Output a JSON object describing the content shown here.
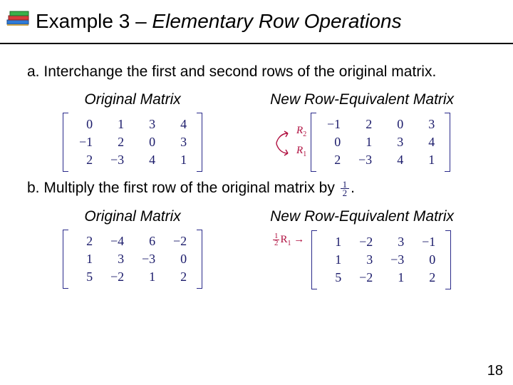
{
  "title": {
    "lead": "Example 3 – ",
    "ital": "Elementary Row Operations"
  },
  "partA": {
    "label": "a.",
    "text": "Interchange the first and second rows of the original matrix.",
    "left_head": "Original Matrix",
    "right_head": "New Row-Equivalent Matrix",
    "original": [
      [
        "0",
        "1",
        "3",
        "4"
      ],
      [
        "−1",
        "2",
        "0",
        "3"
      ],
      [
        "2",
        "−3",
        "4",
        "1"
      ]
    ],
    "result": [
      [
        "−1",
        "2",
        "0",
        "3"
      ],
      [
        "0",
        "1",
        "3",
        "4"
      ],
      [
        "2",
        "−3",
        "4",
        "1"
      ]
    ],
    "rowlabels": [
      "R",
      "2",
      "R",
      "1"
    ],
    "swap_icon": "row-swap-arrow"
  },
  "partB": {
    "label": "b.",
    "text_pre": "Multiply the first row of the original matrix by ",
    "frac_num": "1",
    "frac_den": "2",
    "text_post": ".",
    "left_head": "Original Matrix",
    "right_head": "New Row-Equivalent Matrix",
    "original": [
      [
        "2",
        "−4",
        "6",
        "−2"
      ],
      [
        "1",
        "3",
        "−3",
        "0"
      ],
      [
        "5",
        "−2",
        "1",
        "2"
      ]
    ],
    "result": [
      [
        "1",
        "−2",
        "3",
        "−1"
      ],
      [
        "1",
        "3",
        "−3",
        "0"
      ],
      [
        "5",
        "−2",
        "1",
        "2"
      ]
    ],
    "rowop": {
      "frac_num": "1",
      "frac_den": "2",
      "R": "R",
      "sub": "1",
      "arrow": "→"
    }
  },
  "page_number": "18",
  "chart_data": {
    "type": "table",
    "title": "Elementary Row Operations example matrices",
    "tables": [
      {
        "name": "a_original",
        "rows": [
          [
            0,
            1,
            3,
            4
          ],
          [
            -1,
            2,
            0,
            3
          ],
          [
            2,
            -3,
            4,
            1
          ]
        ]
      },
      {
        "name": "a_result",
        "rows": [
          [
            -1,
            2,
            0,
            3
          ],
          [
            0,
            1,
            3,
            4
          ],
          [
            2,
            -3,
            4,
            1
          ]
        ]
      },
      {
        "name": "b_original",
        "rows": [
          [
            2,
            -4,
            6,
            -2
          ],
          [
            1,
            3,
            -3,
            0
          ],
          [
            5,
            -2,
            1,
            2
          ]
        ]
      },
      {
        "name": "b_result",
        "rows": [
          [
            1,
            -2,
            3,
            -1
          ],
          [
            1,
            3,
            -3,
            0
          ],
          [
            5,
            -2,
            1,
            2
          ]
        ]
      }
    ]
  }
}
